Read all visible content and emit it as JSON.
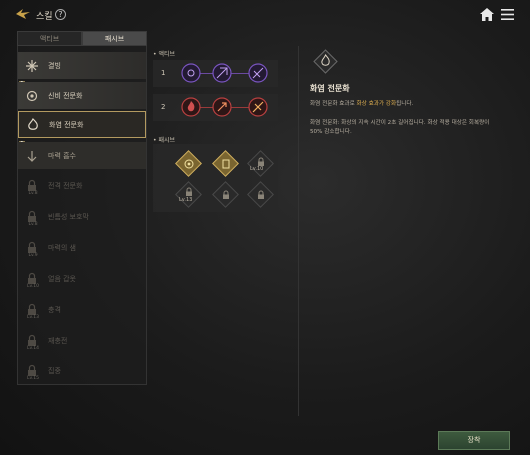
{
  "header": {
    "title": "스킬",
    "help_glyph": "?"
  },
  "tabs": [
    {
      "label": "액티브",
      "active": false
    },
    {
      "label": "패시브",
      "active": true
    }
  ],
  "skills": [
    {
      "label": "결빙",
      "lv": "",
      "state": "unlocked",
      "icon": "snowflake-icon"
    },
    {
      "label": "신비 전문화",
      "lv": "",
      "state": "unlocked",
      "icon": "arcane-eye-icon"
    },
    {
      "label": "화염 전문화",
      "lv": "",
      "state": "selected",
      "icon": "flame-icon"
    },
    {
      "label": "마력 흡수",
      "lv": "",
      "state": "dim",
      "icon": "absorb-icon"
    },
    {
      "label": "전격 전문화",
      "lv": "Lv.8",
      "state": "locked",
      "icon": "lock-icon"
    },
    {
      "label": "빈틈성 보호막",
      "lv": "Lv.8",
      "state": "locked",
      "icon": "lock-icon"
    },
    {
      "label": "마력의 샘",
      "lv": "Lv.9",
      "state": "locked",
      "icon": "lock-icon"
    },
    {
      "label": "얼음 갑옷",
      "lv": "Lv.10",
      "state": "locked",
      "icon": "lock-icon"
    },
    {
      "label": "충격",
      "lv": "Lv.13",
      "state": "locked",
      "icon": "lock-icon"
    },
    {
      "label": "재충전",
      "lv": "Lv.14",
      "state": "locked",
      "icon": "lock-icon"
    },
    {
      "label": "집중",
      "lv": "Lv.15",
      "state": "locked",
      "icon": "lock-icon"
    }
  ],
  "middle": {
    "active_label": "액티브",
    "passive_label": "패시브",
    "rows": [
      {
        "num": "1"
      },
      {
        "num": "2"
      }
    ],
    "passive_levels": {
      "a": "Lv.10",
      "b": "Lv.13"
    }
  },
  "detail": {
    "name": "화염 전문화",
    "line1_a": "화염 전문화 효과로 ",
    "line1_hl": "화상 효과가 강화",
    "line1_b": "됩니다.",
    "line2": "화염 전문화: 화상의 지속 시간이 2초 길어집니다. 화상 적용 대상은 회복량이",
    "line3": "50% 감소합니다."
  },
  "footer": {
    "equip_label": "장착"
  },
  "colors": {
    "accent_gold": "#e0b050",
    "equip_green": "#3e5a3e",
    "purple": "#8a5ad0",
    "red": "#c04040"
  }
}
